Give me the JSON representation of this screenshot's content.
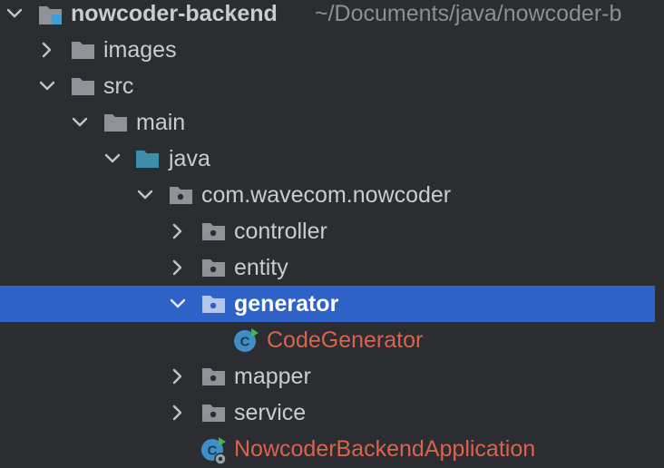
{
  "project": {
    "name": "nowcoder-backend",
    "path": "~/Documents/java/nowcoder-b"
  },
  "tree": {
    "images": "images",
    "src": "src",
    "main": "main",
    "java": "java",
    "package": "com.wavecom.nowcoder",
    "controller": "controller",
    "entity": "entity",
    "generator": "generator",
    "code_generator": "CodeGenerator",
    "mapper": "mapper",
    "service": "service",
    "application": "NowcoderBackendApplication"
  },
  "colors": {
    "background": "#2b2d30",
    "selection": "#2e62c7",
    "folder": "#8f9399",
    "source_folder": "#3d8dad",
    "java_class_text": "#d9634f",
    "class_badge": "#3f8ec5"
  },
  "icons": [
    "chevron-down-icon",
    "chevron-right-icon",
    "module-folder-icon",
    "folder-icon",
    "source-folder-icon",
    "package-folder-icon",
    "java-class-icon",
    "spring-boot-class-icon"
  ]
}
